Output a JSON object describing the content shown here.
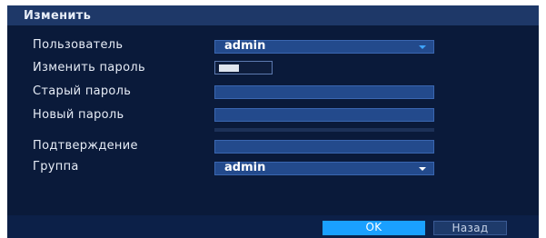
{
  "dialog": {
    "title": "Изменить",
    "fields": {
      "user": {
        "label": "Пользователь",
        "value": "admin"
      },
      "change_password": {
        "label": "Изменить пароль",
        "enabled": true
      },
      "old_password": {
        "label": "Старый пароль",
        "value": ""
      },
      "new_password": {
        "label": "Новый пароль",
        "value": ""
      },
      "confirm": {
        "label": "Подтверждение",
        "value": ""
      },
      "group": {
        "label": "Группа",
        "value": "admin"
      }
    },
    "buttons": {
      "ok": "OK",
      "back": "Назад"
    },
    "colors": {
      "accent": "#1aa0ff",
      "panel": "#0a1a3a",
      "field": "#234a8c"
    }
  }
}
